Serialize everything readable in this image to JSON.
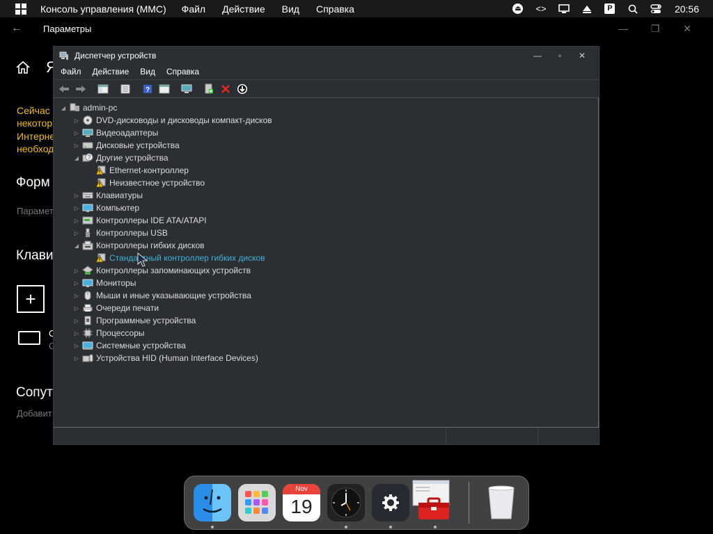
{
  "menubar": {
    "app_name": "Консоль управления (MMC)",
    "menus": [
      "Файл",
      "Действие",
      "Вид",
      "Справка"
    ],
    "tray_icons": [
      "eject-icon",
      "code-icon",
      "monitor-icon",
      "triangle-up-icon",
      "p-icon",
      "search-icon",
      "toggle-icon"
    ],
    "clock": "20:56"
  },
  "settings": {
    "title": "Параметры",
    "bg_letter": "Я",
    "yellow_lines": [
      "Сейчас ",
      "некотор",
      "Интерне",
      "необход"
    ],
    "section1": "Форм",
    "section1_sub": "Парамет",
    "section2": "Клави",
    "kbd_a": "C",
    "kbd_b": "C",
    "section3": "Сопут",
    "section3_sub": "Добавит"
  },
  "mmc": {
    "title": "Диспетчер устройств",
    "menus": [
      "Файл",
      "Действие",
      "Вид",
      "Справка"
    ],
    "tree": [
      {
        "label": "admin-pc",
        "level": 0,
        "expanded": true,
        "icon": "computer-icon"
      },
      {
        "label": "DVD-дисководы и дисководы компакт-дисков",
        "level": 1,
        "icon": "dvd-icon"
      },
      {
        "label": "Видеоадаптеры",
        "level": 1,
        "icon": "display-adapter-icon"
      },
      {
        "label": "Дисковые устройства",
        "level": 1,
        "icon": "disk-drive-icon"
      },
      {
        "label": "Другие устройства",
        "level": 1,
        "expanded": true,
        "icon": "unknown-device-icon"
      },
      {
        "label": "Ethernet-контроллер",
        "level": 2,
        "icon": "warning-device-icon"
      },
      {
        "label": "Неизвестное устройство",
        "level": 2,
        "icon": "warning-device-icon"
      },
      {
        "label": "Клавиатуры",
        "level": 1,
        "icon": "keyboard-icon"
      },
      {
        "label": "Компьютер",
        "level": 1,
        "icon": "monitor-icon"
      },
      {
        "label": "Контроллеры IDE ATA/ATAPI",
        "level": 1,
        "icon": "ide-controller-icon"
      },
      {
        "label": "Контроллеры USB",
        "level": 1,
        "icon": "usb-icon"
      },
      {
        "label": "Контроллеры гибких дисков",
        "level": 1,
        "expanded": true,
        "icon": "floppy-controller-icon"
      },
      {
        "label": "Стандартный контроллер гибких дисков",
        "level": 2,
        "icon": "warning-device-icon",
        "selected": true
      },
      {
        "label": "Контроллеры запоминающих устройств",
        "level": 1,
        "icon": "storage-controller-icon"
      },
      {
        "label": "Мониторы",
        "level": 1,
        "icon": "monitor-icon"
      },
      {
        "label": "Мыши и иные указывающие устройства",
        "level": 1,
        "icon": "mouse-icon"
      },
      {
        "label": "Очереди печати",
        "level": 1,
        "icon": "printer-icon"
      },
      {
        "label": "Программные устройства",
        "level": 1,
        "icon": "software-device-icon"
      },
      {
        "label": "Процессоры",
        "level": 1,
        "icon": "processor-icon"
      },
      {
        "label": "Системные устройства",
        "level": 1,
        "icon": "system-device-icon"
      },
      {
        "label": "Устройства HID (Human Interface Devices)",
        "level": 1,
        "icon": "hid-icon"
      }
    ]
  },
  "dock": {
    "calendar_month": "Nov",
    "calendar_day": "19",
    "items": [
      "finder-icon",
      "launchpad-icon",
      "calendar-icon",
      "clock-icon",
      "settings-icon",
      "toolbox-icon",
      "trash-icon"
    ]
  },
  "colors": {
    "accent": "#3fb4d8",
    "warning": "#f0c000",
    "window_bg": "#2b2f33"
  }
}
